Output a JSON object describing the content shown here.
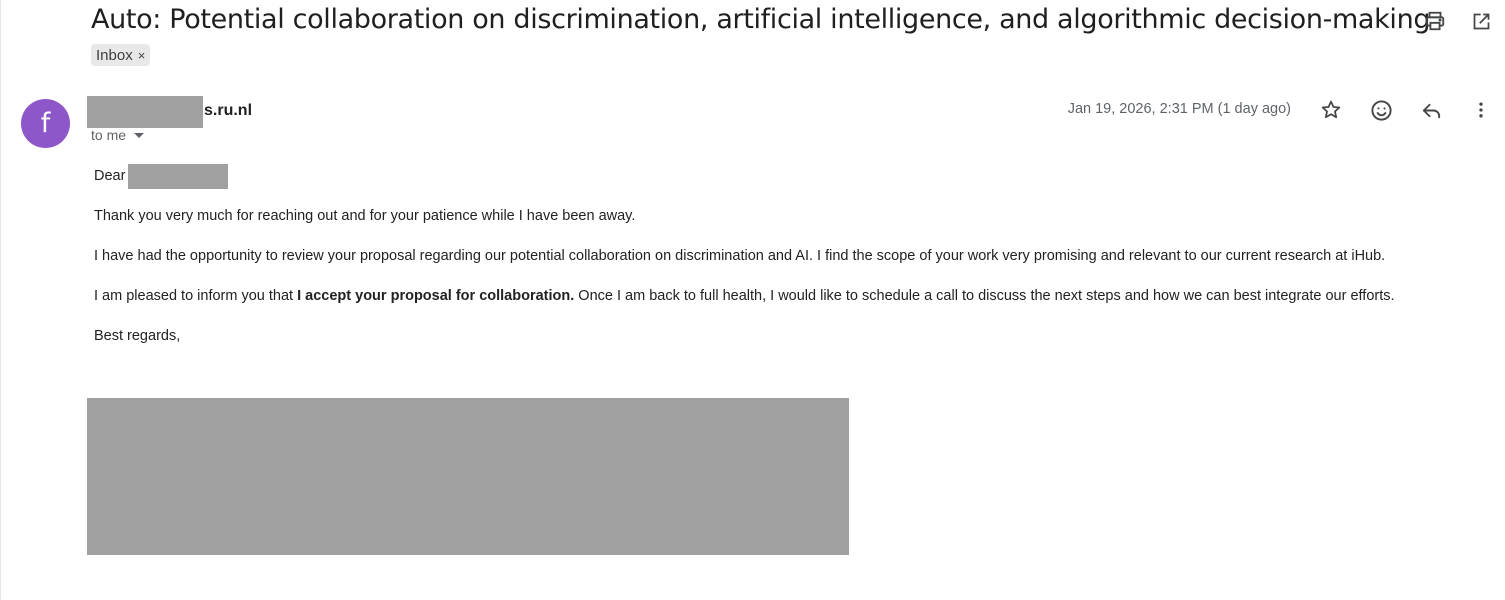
{
  "email": {
    "subject": "Auto: Potential collaboration on discrimination, artificial intelligence, and algorithmic decision-making",
    "label": "Inbox",
    "label_remove": "×",
    "sender": {
      "avatar_letter": "f",
      "avatar_color": "#8e57c9",
      "email_suffix": "s.ru.nl"
    },
    "recipient": "to me",
    "date": "Jan 19, 2026, 2:31 PM (1 day ago)",
    "body": {
      "greeting": "Dear",
      "paragraph_1": "Thank you very much for reaching out and for your patience while I have been away.",
      "paragraph_2": "I have had the opportunity to review your proposal regarding our potential collaboration on discrimination and AI. I find the scope of your work very promising and relevant to our current research at iHub.",
      "paragraph_3_start": "I am pleased to inform you that ",
      "paragraph_3_bold": "I accept your proposal for collaboration.",
      "paragraph_3_end": " Once I am back to full health, I would like to schedule a call to discuss the next steps and how we can best integrate our efforts.",
      "closing": "Best regards,"
    }
  },
  "toolbar": {
    "icons": [
      "print-icon",
      "open-in-new-window-icon"
    ]
  },
  "message_actions": {
    "icons": [
      "star-icon",
      "emoji-reaction-icon",
      "reply-icon",
      "more-options-icon"
    ]
  },
  "colors": {
    "redaction": "#a0a0a0",
    "chip_background": "#e8e8e8"
  }
}
